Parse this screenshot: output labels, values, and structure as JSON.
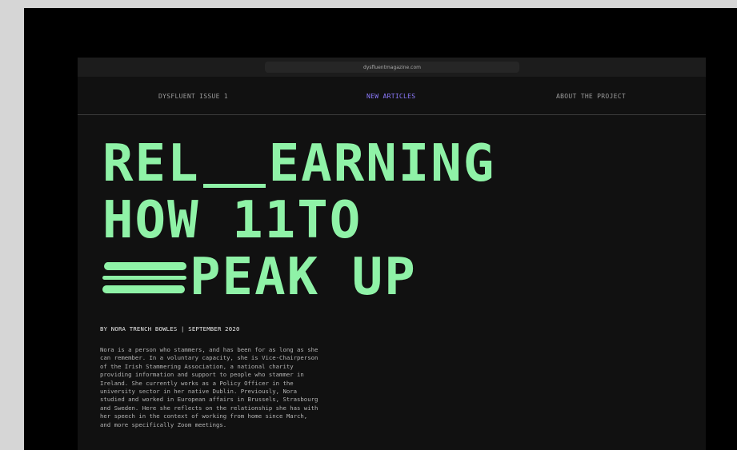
{
  "browser": {
    "url": "dysfluentmagazine.com"
  },
  "nav": {
    "issue": "DYSFLUENT ISSUE 1",
    "articles": "NEW ARTICLES",
    "about": "ABOUT THE PROJECT"
  },
  "article": {
    "headline_line1_a": "REL",
    "headline_line1_b": "EARNING",
    "headline_line2": "HOW 11TO",
    "headline_line3": "PEAK UP",
    "byline": "BY NORA TRENCH BOWLES | SEPTEMBER 2020",
    "bio_lines": [
      "Nora is a person who stammers, and has been for as long as she",
      "can remember. In a voluntary capacity, she is Vice-Chairperson",
      "of the Irish Stammering Association, a national charity",
      "providing information and support to people who stammer in",
      "Ireland. She currently works as a Policy Officer in the",
      "university sector in her native Dublin. Previously, Nora",
      "studied and worked in European affairs in Brussels, Strasbourg",
      "and Sweden. Here she reflects on the relationship she has with",
      "her speech in the context of working from home since March,",
      "and more specifically Zoom meetings."
    ]
  },
  "colors": {
    "headline": "#8ff2a7",
    "active_nav": "#8d7bff",
    "background": "#111111"
  }
}
